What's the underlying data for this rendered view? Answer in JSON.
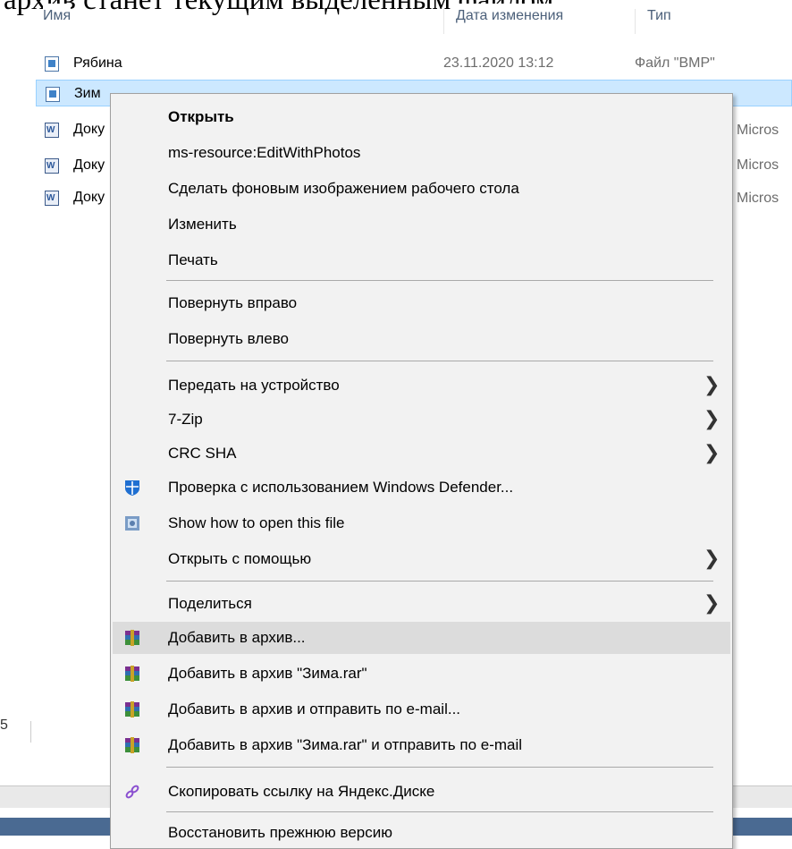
{
  "document_text": "архив станет текущим выделенным файлом.",
  "columns": {
    "name": "Имя",
    "date": "Дата изменения",
    "type": "Тип"
  },
  "files": [
    {
      "name": "Рябина",
      "date": "23.11.2020 13:12",
      "type": "Файл \"BMP\"",
      "icon": "bmp-file-icon"
    },
    {
      "name": "Зим",
      "date": "",
      "type": "",
      "icon": "bmp-file-icon"
    },
    {
      "name": "Доку",
      "date": "",
      "type": "Micros",
      "icon": "word-document-icon"
    },
    {
      "name": "Доку",
      "date": "",
      "type": "Micros",
      "icon": "word-document-icon"
    },
    {
      "name": "Доку",
      "date": "",
      "type": "Micros",
      "icon": "word-document-icon"
    }
  ],
  "status_bar_left": "5",
  "context_menu": {
    "items": [
      {
        "label": "Открыть",
        "bold": true
      },
      {
        "label": "ms-resource:EditWithPhotos"
      },
      {
        "label": "Сделать фоновым изображением рабочего стола"
      },
      {
        "label": "Изменить"
      },
      {
        "label": "Печать"
      },
      {
        "label": "Повернуть вправо"
      },
      {
        "label": "Повернуть влево"
      },
      {
        "label": "Передать на устройство",
        "submenu": true
      },
      {
        "label": "7-Zip",
        "submenu": true
      },
      {
        "label": "CRC SHA",
        "submenu": true
      },
      {
        "label": "Проверка с использованием Windows Defender...",
        "icon": "windows-defender-icon"
      },
      {
        "label": "Show how to open this file",
        "icon": "open-with-icon"
      },
      {
        "label": "Открыть с помощью",
        "submenu": true
      },
      {
        "label": "Поделиться",
        "submenu": true
      },
      {
        "label": "Добавить в архив...",
        "icon": "winrar-icon",
        "highlighted": true
      },
      {
        "label": "Добавить в архив \"Зима.rar\"",
        "icon": "winrar-icon"
      },
      {
        "label": "Добавить в архив и отправить по e-mail...",
        "icon": "winrar-icon"
      },
      {
        "label": "Добавить в архив \"Зима.rar\" и отправить по e-mail",
        "icon": "winrar-icon"
      },
      {
        "label": "Скопировать ссылку на Яндекс.Диске",
        "icon": "yandex-link-icon"
      },
      {
        "label": "Восстановить прежнюю версию"
      }
    ],
    "submenu_arrow": "❯"
  },
  "colors": {
    "selection": "#cce8ff",
    "menu_background": "#f2f2f2",
    "menu_hover": "#dcdcdc",
    "defender_blue": "#1f6fd1",
    "winrar_purple": "#7a2f8f",
    "yandex_link": "#8a4fd0"
  }
}
